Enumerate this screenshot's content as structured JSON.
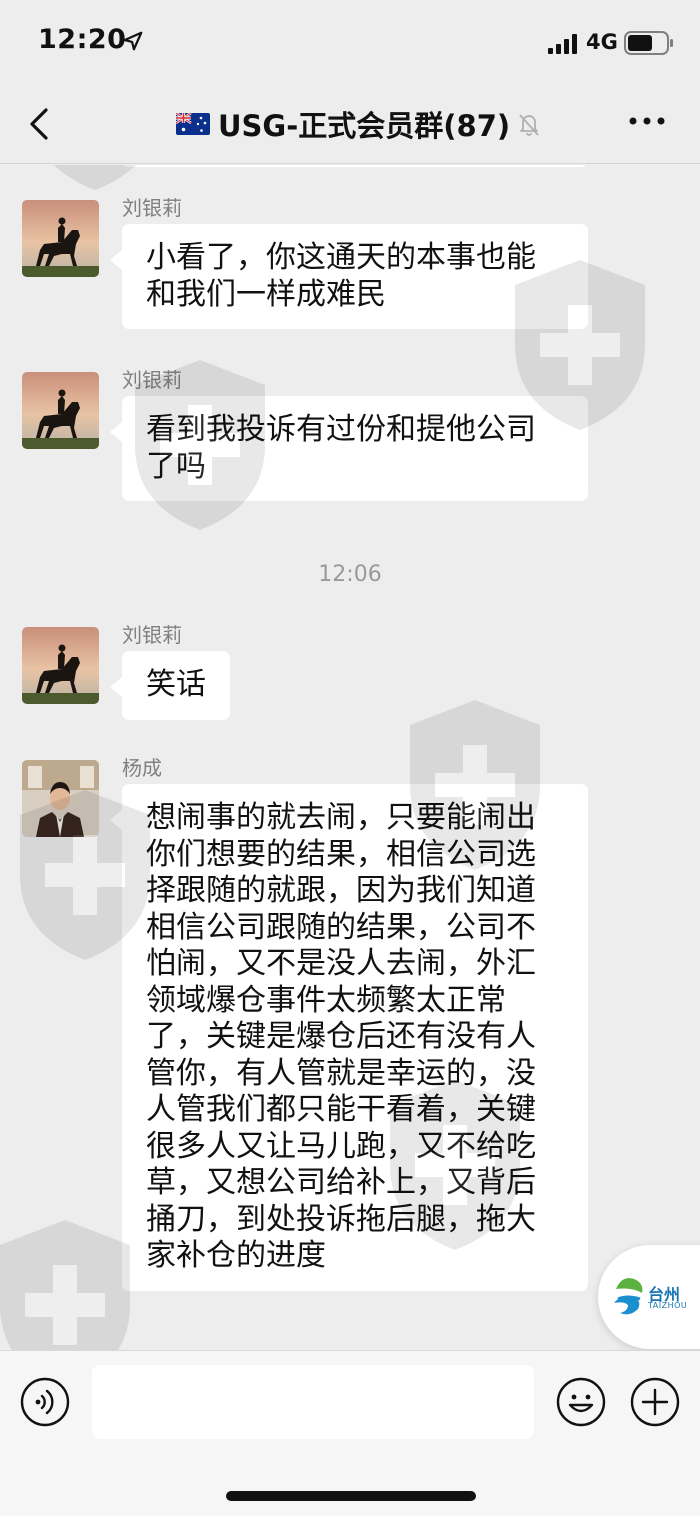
{
  "status_bar": {
    "time": "12:20",
    "network": "4G",
    "icons": [
      "location-arrow-icon",
      "signal-icon",
      "battery-icon"
    ]
  },
  "header": {
    "flag": "australia-flag-icon",
    "title": "USG-正式会员群(87)",
    "muted_icon": "mute-bell-icon",
    "back_icon": "back-chevron-icon",
    "more_icon": "more-dots-icon"
  },
  "messages": [
    {
      "sender": "刘银莉",
      "avatar": "horse-rider-avatar",
      "text": "小看了，你这通天的本事也能\n和我们一样成难民"
    },
    {
      "sender": "刘银莉",
      "avatar": "horse-rider-avatar",
      "text": "看到我投诉有过份和提他公司\n了吗"
    },
    {
      "timestamp": "12:06"
    },
    {
      "sender": "刘银莉",
      "avatar": "horse-rider-avatar",
      "text": "笑话"
    },
    {
      "sender": "杨成",
      "avatar": "man-in-suit-avatar",
      "text": "想闹事的就去闹，只要能闹出\n你们想要的结果，相信公司选\n择跟随的就跟，因为我们知道\n相信公司跟随的结果，公司不\n怕闹，又不是没人去闹，外汇\n领域爆仓事件太频繁太正常\n了，关键是爆仓后还有没有人\n管你，有人管就是幸运的，没\n人管我们都只能干看着，关键\n很多人又让马儿跑，又不给吃\n草，又想公司给补上，又背后\n捅刀，到处投诉拖后腿，拖大\n家补仓的进度"
    }
  ],
  "floating_badge": {
    "title": "台州",
    "subtitle": "TAIZHOU"
  },
  "input_bar": {
    "placeholder": "",
    "voice_icon": "voice-icon",
    "emoji_icon": "emoji-icon",
    "plus_icon": "plus-icon"
  },
  "colors": {
    "background": "#ededed",
    "bubble": "#ffffff",
    "sender_name": "#808080",
    "timestamp": "#9a9a9a"
  }
}
